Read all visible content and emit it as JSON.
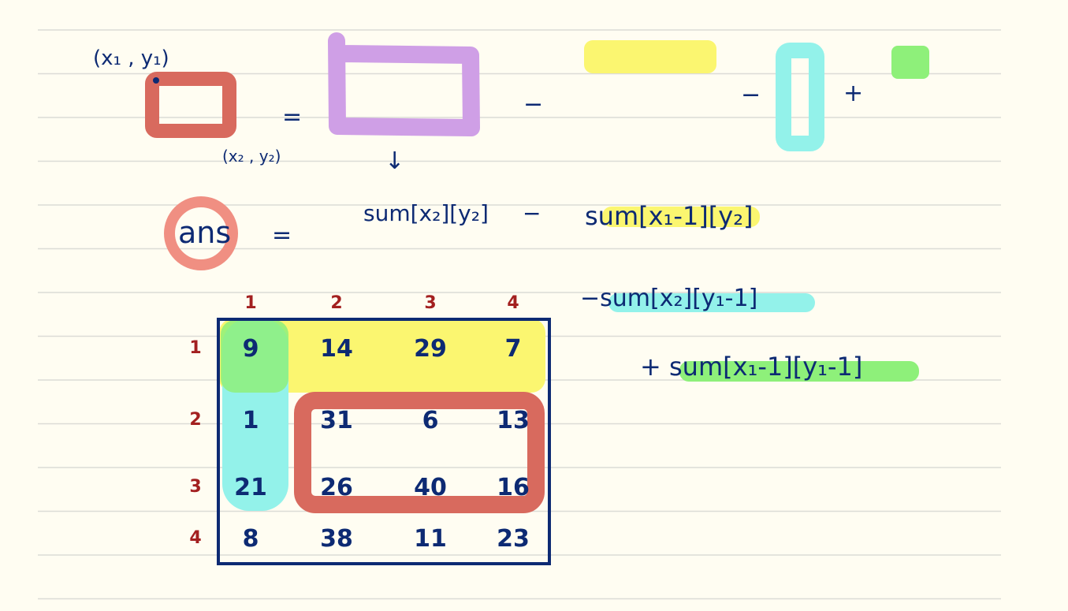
{
  "colors": {
    "background": "#fffdf2",
    "ruled_line": "#dcdcd6",
    "ink_navy": "#0d2a73",
    "ink_red": "#a32020",
    "red": "#d86a5e",
    "purple": "#cf9fe6",
    "yellow": "#fbf670",
    "cyan": "#93f2ea",
    "green": "#8ef07a",
    "salmon": "#f08f82"
  },
  "top": {
    "p1_label": "(x₁ , y₁)",
    "p2_label": "(x₂ , y₂)",
    "equals": "=",
    "minus_1": "−",
    "minus_2": "−",
    "plus": "+",
    "down_arrow": "↓"
  },
  "formula": {
    "ans": "ans",
    "equals": "=",
    "term1": "sum[x₂][y₂]",
    "minus": "−",
    "term2": "sum[x₁-1][y₂]",
    "term3": "−sum[x₂][y₁-1]",
    "term4": "+ sum[x₁-1][y₁-1]"
  },
  "grid": {
    "col_labels": [
      "1",
      "2",
      "3",
      "4"
    ],
    "row_labels": [
      "1",
      "2",
      "3",
      "4"
    ],
    "cells": [
      [
        "9",
        "14",
        "29",
        "7"
      ],
      [
        "1",
        "31",
        "6",
        "13"
      ],
      [
        "21",
        "26",
        "40",
        "16"
      ],
      [
        "8",
        "38",
        "11",
        "23"
      ]
    ]
  }
}
